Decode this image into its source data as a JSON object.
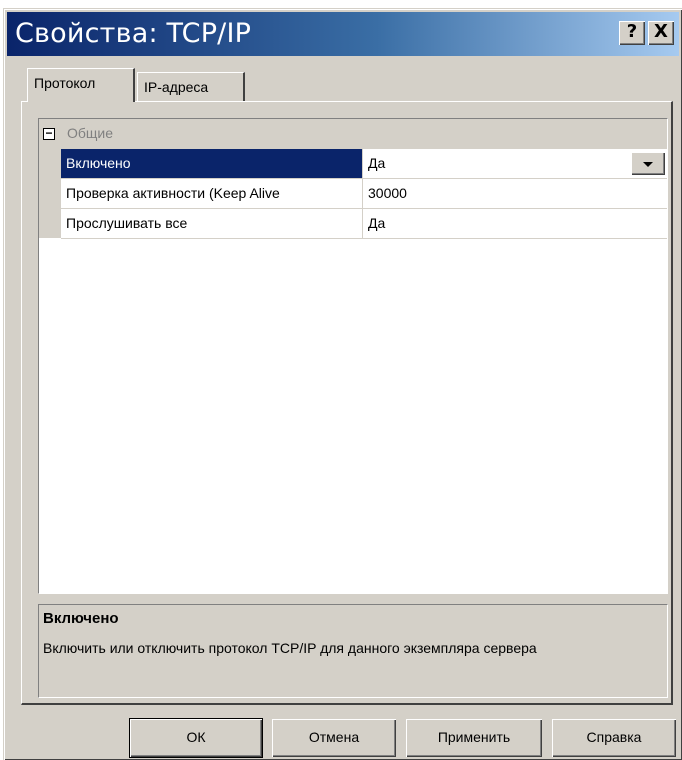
{
  "window": {
    "title": "Свойства: TCP/IP",
    "help_button": "?",
    "close_button": "X"
  },
  "tabs": [
    {
      "label": "Протокол",
      "active": true
    },
    {
      "label": "IP-адреса",
      "active": false
    }
  ],
  "grid": {
    "category": {
      "label": "Общие",
      "expand_symbol": "−"
    },
    "properties": [
      {
        "name": "Включено",
        "value": "Да",
        "selected": true,
        "has_dropdown": true
      },
      {
        "name": "Проверка активности (Keep Alive",
        "value": "30000",
        "selected": false
      },
      {
        "name": "Прослушивать все",
        "value": "Да",
        "selected": false
      }
    ]
  },
  "description": {
    "title": "Включено",
    "text": "Включить или отключить протокол TCP/IP для данного экземпляра сервера"
  },
  "buttons": {
    "ok": "ОК",
    "cancel": "Отмена",
    "apply": "Применить",
    "help": "Справка"
  },
  "colors": {
    "title_gradient_start": "#0a246a",
    "selection": "#0a246a",
    "face": "#d4d0c8"
  }
}
